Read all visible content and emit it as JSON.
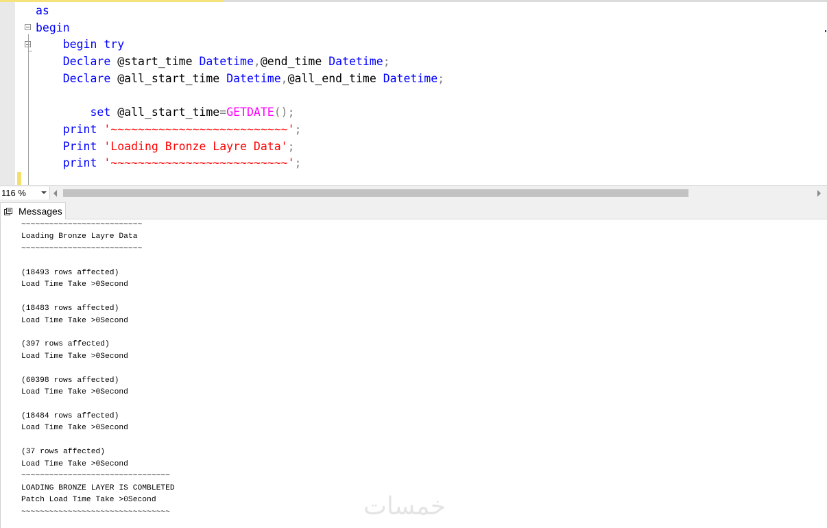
{
  "editor": {
    "lines": [
      [
        {
          "t": "as",
          "c": "kw"
        }
      ],
      [
        {
          "t": "begin",
          "c": "kw"
        }
      ],
      [
        {
          "t": "    "
        },
        {
          "t": "begin try",
          "c": "kw"
        }
      ],
      [
        {
          "t": "    "
        },
        {
          "t": "Declare",
          "c": "kw"
        },
        {
          "t": " @start_time "
        },
        {
          "t": "Datetime",
          "c": "kw"
        },
        {
          "t": ",",
          "c": "op"
        },
        {
          "t": "@end_time "
        },
        {
          "t": "Datetime",
          "c": "kw"
        },
        {
          "t": ";",
          "c": "op"
        }
      ],
      [
        {
          "t": "    "
        },
        {
          "t": "Declare",
          "c": "kw"
        },
        {
          "t": " @all_start_time "
        },
        {
          "t": "Datetime",
          "c": "kw"
        },
        {
          "t": ",",
          "c": "op"
        },
        {
          "t": "@all_end_time "
        },
        {
          "t": "Datetime",
          "c": "kw"
        },
        {
          "t": ";",
          "c": "op"
        }
      ],
      [
        {
          "t": ""
        }
      ],
      [
        {
          "t": "        "
        },
        {
          "t": "set",
          "c": "kw"
        },
        {
          "t": " @all_start_time"
        },
        {
          "t": "=",
          "c": "op"
        },
        {
          "t": "GETDATE",
          "c": "fn"
        },
        {
          "t": "();",
          "c": "op"
        }
      ],
      [
        {
          "t": "    "
        },
        {
          "t": "print",
          "c": "kw"
        },
        {
          "t": " "
        },
        {
          "t": "'~~~~~~~~~~~~~~~~~~~~~~~~~~'",
          "c": "str"
        },
        {
          "t": ";",
          "c": "op"
        }
      ],
      [
        {
          "t": "    "
        },
        {
          "t": "Print",
          "c": "kw"
        },
        {
          "t": " "
        },
        {
          "t": "'Loading Bronze Layre Data'",
          "c": "str"
        },
        {
          "t": ";",
          "c": "op"
        }
      ],
      [
        {
          "t": "    "
        },
        {
          "t": "print",
          "c": "kw"
        },
        {
          "t": " "
        },
        {
          "t": "'~~~~~~~~~~~~~~~~~~~~~~~~~~'",
          "c": "str"
        },
        {
          "t": ";",
          "c": "op"
        }
      ]
    ]
  },
  "statusbar": {
    "zoom": "116 %"
  },
  "results": {
    "tab_label": "Messages",
    "tab_icon": "messages-icon",
    "output": [
      "~~~~~~~~~~~~~~~~~~~~~~~~~~",
      "Loading Bronze Layre Data",
      "~~~~~~~~~~~~~~~~~~~~~~~~~~",
      "",
      "(18493 rows affected)",
      "Load Time Take >0Second",
      "",
      "(18483 rows affected)",
      "Load Time Take >0Second",
      "",
      "(397 rows affected)",
      "Load Time Take >0Second",
      "",
      "(60398 rows affected)",
      "Load Time Take >0Second",
      "",
      "(18484 rows affected)",
      "Load Time Take >0Second",
      "",
      "(37 rows affected)",
      "Load Time Take >0Second",
      "~~~~~~~~~~~~~~~~~~~~~~~~~~~~~~~~",
      "LOADING BRONZE LAYER IS COMBLETED",
      "Patch Load Time Take >0Second",
      "~~~~~~~~~~~~~~~~~~~~~~~~~~~~~~~~"
    ]
  },
  "watermark": "خمسات",
  "colors": {
    "keyword": "#0000ff",
    "string": "#ff0000",
    "function": "#ff00ff",
    "operator": "#808080",
    "change_marker": "#f3df6a"
  }
}
